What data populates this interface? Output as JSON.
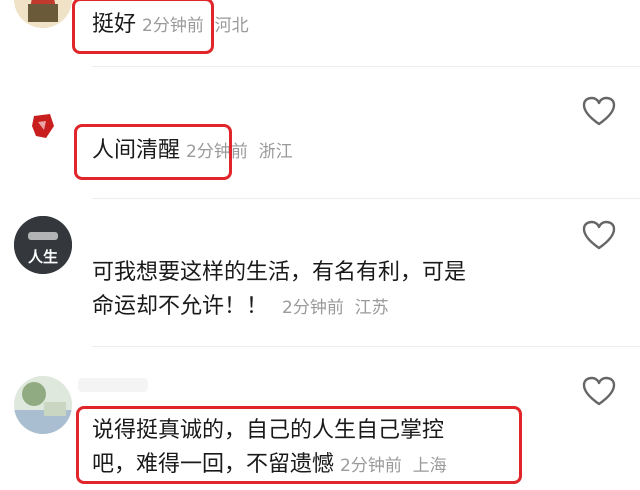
{
  "comments": [
    {
      "text": "挺好",
      "time": "2分钟前",
      "location": "河北"
    },
    {
      "text": "人间清醒",
      "time": "2分钟前",
      "location": "浙江"
    },
    {
      "line1": "可我想要这样的生活，有名有利，可是",
      "line2": "命运却不允许！！",
      "time": "2分钟前",
      "location": "江苏"
    },
    {
      "line1": "说得挺真诚的，自己的人生自己掌控",
      "line2": "吧，难得一回，不留遗憾",
      "time": "2分钟前",
      "location": "上海"
    }
  ],
  "avatar_text": "人生",
  "colors": {
    "highlight": "#e0262b",
    "meta": "#9a9a9a",
    "divider": "#ececec"
  },
  "icons": {
    "like": "heart-outline-icon"
  }
}
